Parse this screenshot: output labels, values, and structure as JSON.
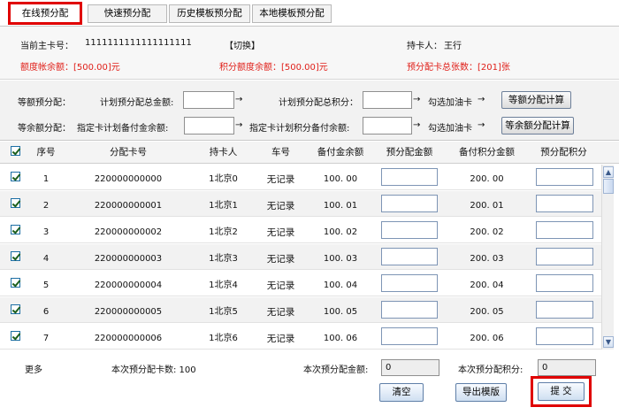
{
  "tabs": [
    {
      "label": "在线预分配",
      "active": true
    },
    {
      "label": "快速预分配",
      "active": false
    },
    {
      "label": "历史模板预分配",
      "active": false
    },
    {
      "label": "本地模板预分配",
      "active": false
    }
  ],
  "info": {
    "main_card_label": "当前主卡号：",
    "main_card_value": "1111111111111111111",
    "switch_label": "【切换】",
    "holder_label": "持卡人：",
    "holder_value": "王行",
    "quota_balance": "额度帐余额：[500.00]元",
    "points_quota_balance": "积分额度余额：[500.00]元",
    "prealloc_card_total": "预分配卡总张数：[201]张"
  },
  "alloc": {
    "equal_label": "等额预分配：",
    "plan_total_amount_label": "计划预分配总金额:",
    "plan_total_points_label": "计划预分配总积分：",
    "check_card_label": "勾选加油卡",
    "equal_calc_button": "等额分配计算",
    "balance_label": "等余额分配：",
    "target_amount_label": "指定卡计划备付金余额:",
    "target_points_label": "指定卡计划积分备付余额:",
    "check_card_label2": "勾选加油卡",
    "balance_calc_button": "等余额分配计算",
    "arrow": "→"
  },
  "table": {
    "headers": [
      "序号",
      "分配卡号",
      "持卡人",
      "车号",
      "备付金余额",
      "预分配金额",
      "备付积分金额",
      "预分配积分"
    ],
    "rows": [
      {
        "seq": "1",
        "card": "220000000000",
        "holder": "1北京0",
        "plate": "无记录",
        "balance": "100. 00",
        "points": "200. 00"
      },
      {
        "seq": "2",
        "card": "220000000001",
        "holder": "1北京1",
        "plate": "无记录",
        "balance": "100. 01",
        "points": "200. 01"
      },
      {
        "seq": "3",
        "card": "220000000002",
        "holder": "1北京2",
        "plate": "无记录",
        "balance": "100. 02",
        "points": "200. 02"
      },
      {
        "seq": "4",
        "card": "220000000003",
        "holder": "1北京3",
        "plate": "无记录",
        "balance": "100. 03",
        "points": "200. 03"
      },
      {
        "seq": "5",
        "card": "220000000004",
        "holder": "1北京4",
        "plate": "无记录",
        "balance": "100. 04",
        "points": "200. 04"
      },
      {
        "seq": "6",
        "card": "220000000005",
        "holder": "1北京5",
        "plate": "无记录",
        "balance": "100. 05",
        "points": "200. 05"
      },
      {
        "seq": "7",
        "card": "220000000006",
        "holder": "1北京6",
        "plate": "无记录",
        "balance": "100. 06",
        "points": "200. 06"
      }
    ]
  },
  "footer": {
    "more_label": "更多",
    "card_count": "本次预分配卡数: 100",
    "amount_label": "本次预分配金额:",
    "amount_value": "0",
    "points_label": "本次预分配积分:",
    "points_value": "0",
    "clear_button": "清空",
    "export_button": "导出模版",
    "submit_button": "提  交"
  },
  "colors": {
    "highlight": "#e00000",
    "red_text": "#e0201a"
  }
}
